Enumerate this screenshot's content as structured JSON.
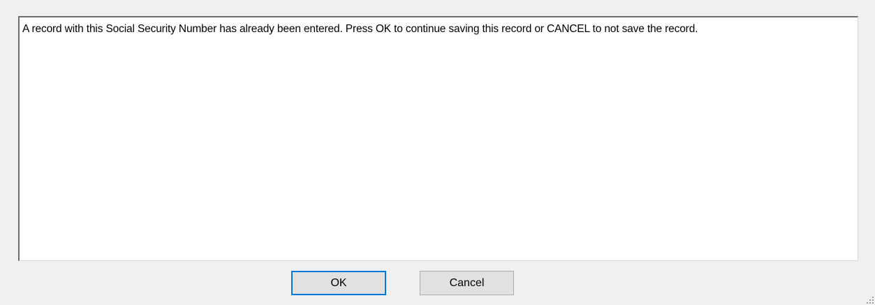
{
  "dialog": {
    "message": "A record with this Social Security Number has already been entered.  Press OK to continue saving this record or CANCEL to not save the record.",
    "ok_label": "OK",
    "cancel_label": "Cancel"
  },
  "icons": {
    "resize_grip": "resize-grip-icon"
  }
}
